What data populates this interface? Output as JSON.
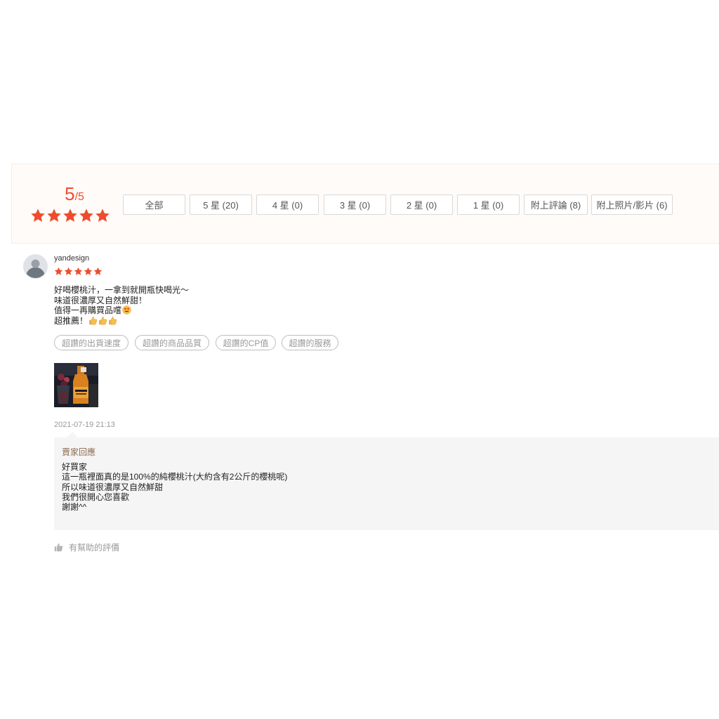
{
  "rating_overview": {
    "score": "5",
    "score_max": "/5",
    "stars": 5,
    "accent_color": "#ee4d2d",
    "filters": [
      {
        "label": "全部",
        "active": true
      },
      {
        "label": "5 星 (20)",
        "active": false
      },
      {
        "label": "4 星 (0)",
        "active": false
      },
      {
        "label": "3 星 (0)",
        "active": false
      },
      {
        "label": "2 星 (0)",
        "active": false
      },
      {
        "label": "1 星 (0)",
        "active": false
      },
      {
        "label": "附上評論 (8)",
        "active": false
      },
      {
        "label": "附上照片/影片 (6)",
        "active": false
      }
    ]
  },
  "review": {
    "username": "yandesign",
    "stars": 5,
    "comment_lines": [
      "好喝櫻桃汁，一拿到就開瓶快喝光～",
      "味道很濃厚又自然鮮甜！",
      "值得一再購買品嚐",
      "超推薦！"
    ],
    "emoji_icons": [
      "smiling-face-with-heart-eyes-icon",
      "thumbs-up-icon"
    ],
    "tags": [
      "超讚的出貨速度",
      "超讚的商品品質",
      "超讚的CP值",
      "超讚的服務"
    ],
    "photo_icon": "review-photo-cherry-juice-bottle",
    "timestamp": "2021-07-19 21:13",
    "seller_reply": {
      "title": "賣家回應",
      "lines": [
        "好買家",
        "這一瓶裡面真的是100%的純櫻桃汁(大約含有2公斤的櫻桃呢)",
        "所以味道很濃厚又自然鮮甜",
        "我們很開心您喜歡",
        "謝謝^^"
      ]
    },
    "helpful_label": "有幫助的評價"
  }
}
